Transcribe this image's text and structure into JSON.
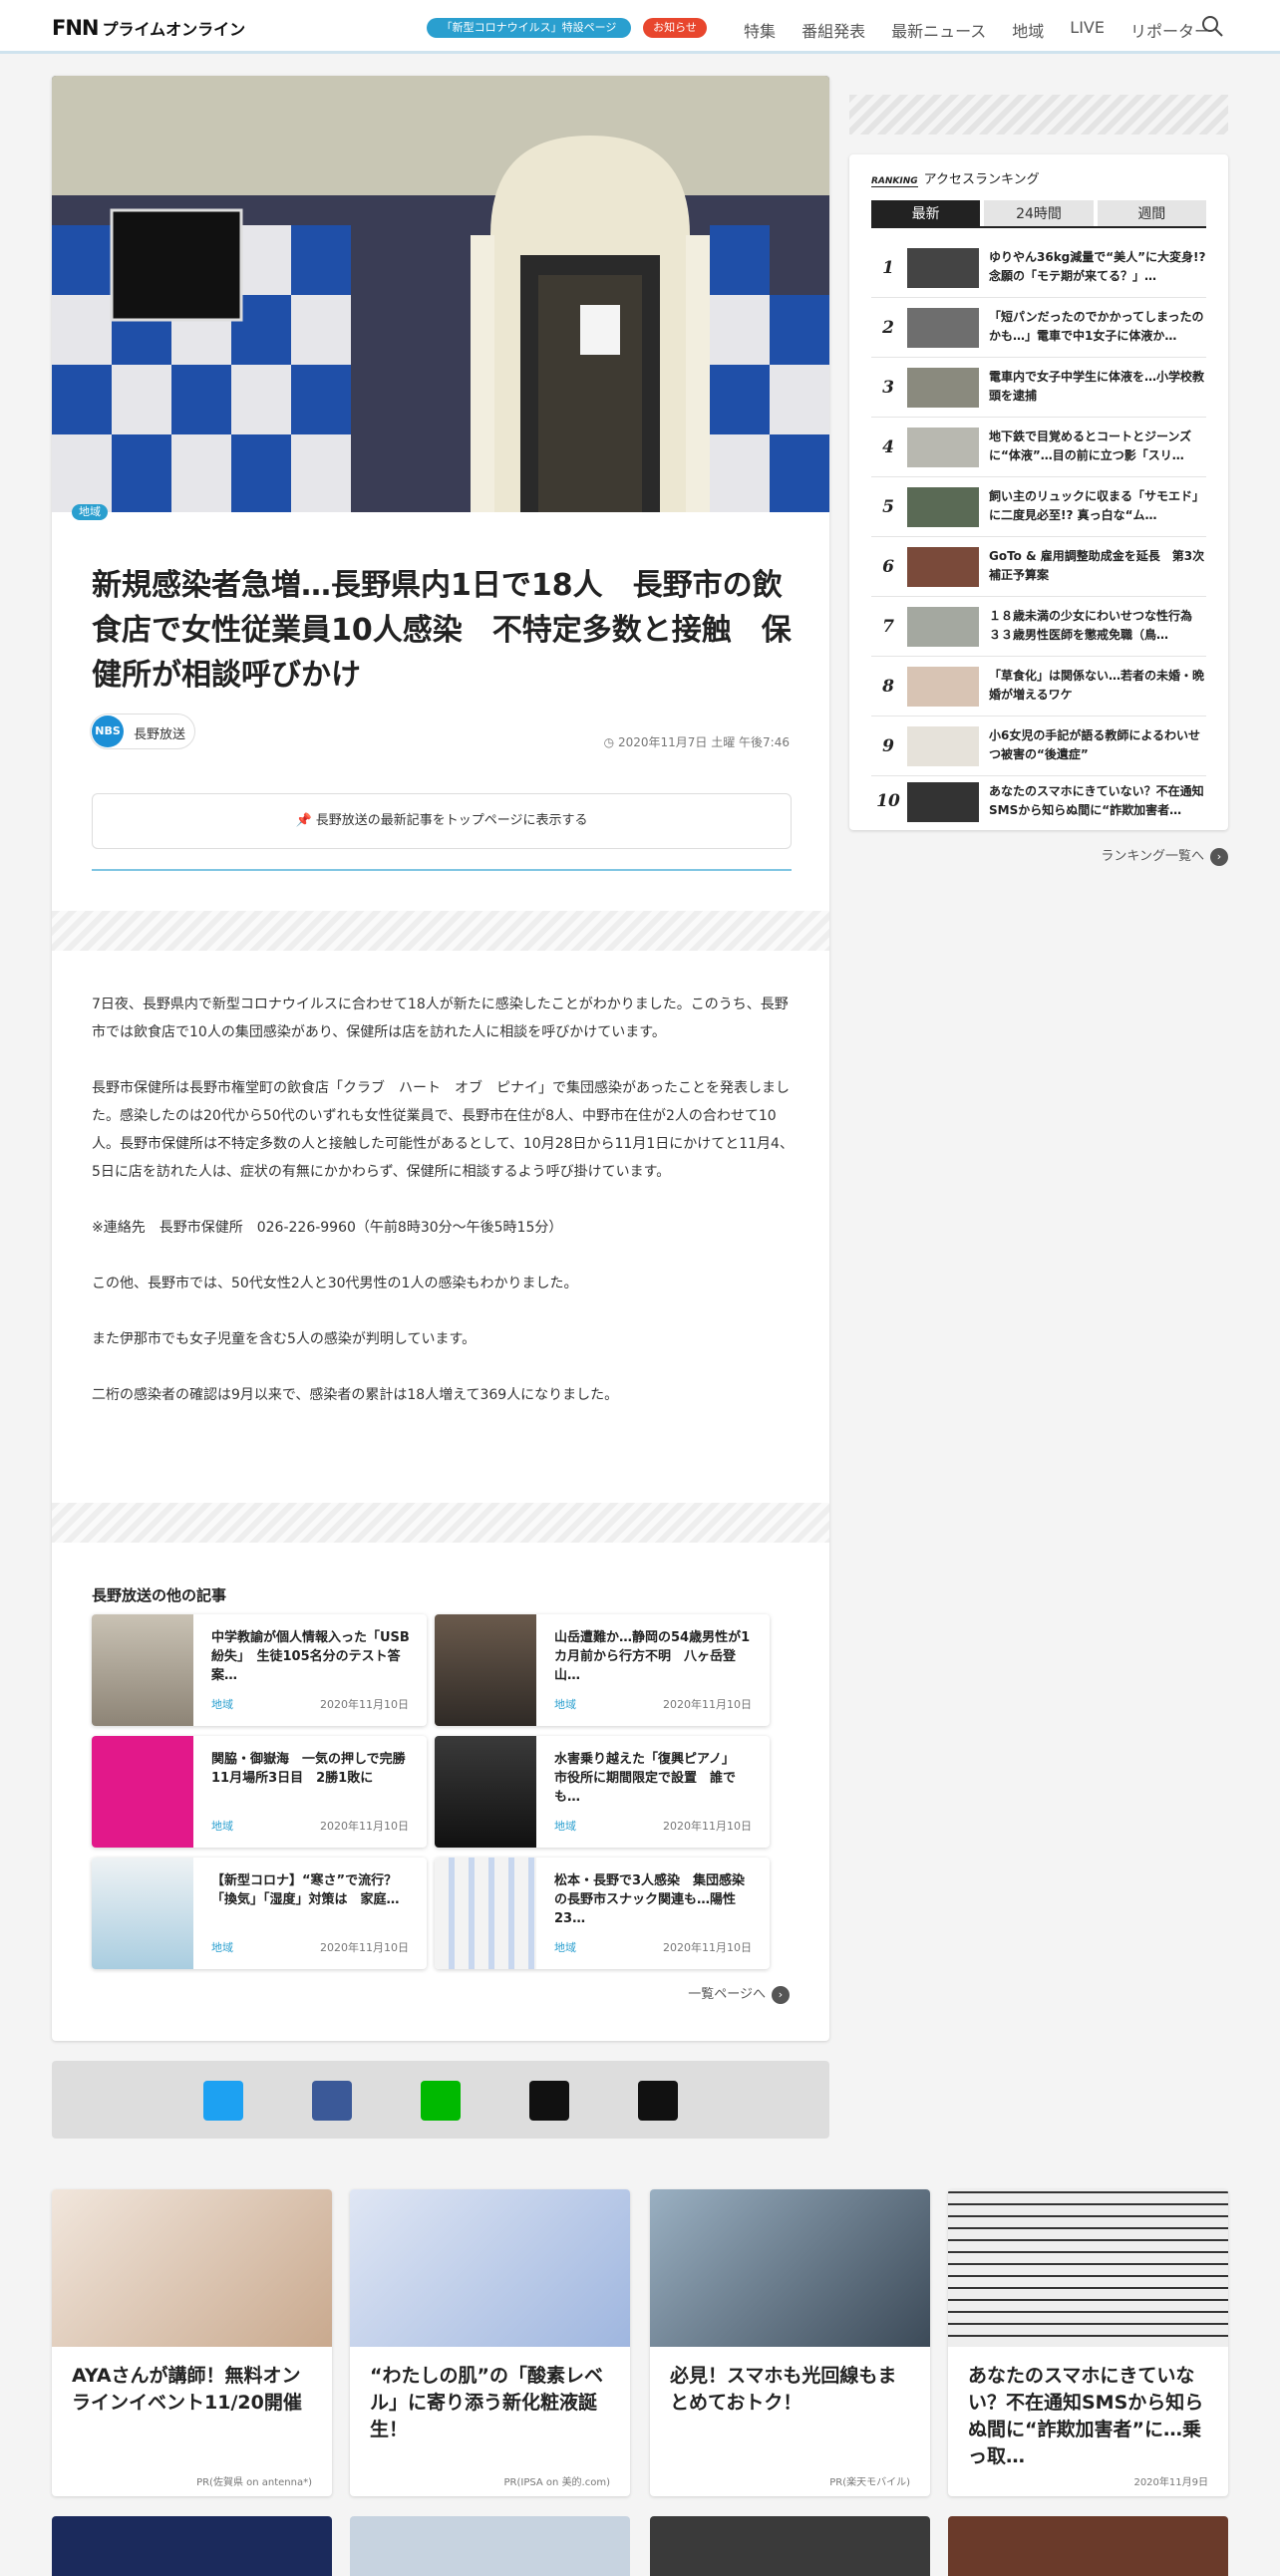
{
  "header": {
    "logo_mark": "FNN",
    "logo_text": "プライムオンライン",
    "covid_pill": "「新型コロナウイルス」特設ページ",
    "notice_pill": "お知らせ",
    "nav": [
      "特集",
      "番組発表",
      "最新ニュース",
      "地域",
      "LIVE",
      "リポーター"
    ]
  },
  "article": {
    "category": "地域",
    "title": "新規感染者急増…長野県内1日で18人　長野市の飲食店で女性従業員10人感染　不特定多数と接触　保健所が相談呼びかけ",
    "source_logo": "NBS",
    "source_name": "長野放送",
    "date": "2020年11月7日 土曜 午後7:46",
    "follow_label": "長野放送の最新記事をトップページに表示する",
    "paragraphs": [
      "7日夜、長野県内で新型コロナウイルスに合わせて18人が新たに感染したことがわかりました。このうち、長野市では飲食店で10人の集団感染があり、保健所は店を訪れた人に相談を呼びかけています。",
      "長野市保健所は長野市権堂町の飲食店「クラブ　ハート　オブ　ピナイ」で集団感染があったことを発表しました。感染したのは20代から50代のいずれも女性従業員で、長野市在住が8人、中野市在住が2人の合わせて10人。長野市保健所は不特定多数の人と接触した可能性があるとして、10月28日から11月1日にかけてと11月4、5日に店を訪れた人は、症状の有無にかかわらず、保健所に相談するよう呼び掛けています。",
      "※連絡先　長野市保健所　026-226-9960（午前8時30分～午後5時15分）",
      "この他、長野市では、50代女性2人と30代男性の1人の感染もわかりました。",
      "また伊那市でも女子児童を含む5人の感染が判明しています。",
      "二桁の感染者の確認は9月以来で、感染者の累計は18人増えて369人になりました。"
    ]
  },
  "related": {
    "heading": "長野放送の他の記事",
    "items": [
      {
        "title": "中学教諭が個人情報入った「USB紛失」　生徒105名分のテスト答案…",
        "category": "地域",
        "date": "2020年11月10日"
      },
      {
        "title": "山岳遭難か…静岡の54歳男性が1カ月前から行方不明　八ヶ岳登山…",
        "category": "地域",
        "date": "2020年11月10日"
      },
      {
        "title": "関脇・御嶽海　一気の押しで完勝　11月場所3日目　2勝1敗に",
        "category": "地域",
        "date": "2020年11月10日"
      },
      {
        "title": "水害乗り越えた「復興ピアノ」　市役所に期間限定で設置　誰でも…",
        "category": "地域",
        "date": "2020年11月10日"
      },
      {
        "title": "【新型コロナ】“寒さ”で流行？　「換気」「湿度」対策は　家庭…",
        "category": "地域",
        "date": "2020年11月10日"
      },
      {
        "title": "松本・長野で3人感染　集団感染の長野市スナック関連も…陽性23…",
        "category": "地域",
        "date": "2020年11月10日"
      }
    ],
    "more_label": "一覧ページへ"
  },
  "share": {
    "icons": [
      "twitter-icon",
      "facebook-icon",
      "line-icon",
      "link-icon",
      "comment-icon"
    ],
    "colors": [
      "#1da1f2",
      "#3b5998",
      "#00b900",
      "#111111",
      "#111111"
    ]
  },
  "ranking": {
    "badge": "RANKING",
    "title": "アクセスランキング",
    "tabs": [
      "最新",
      "24時間",
      "週間"
    ],
    "items": [
      {
        "rank": "1",
        "title": "ゆりやん36kg減量で“美人”に大変身!? 念願の「モテ期が来てる？」…"
      },
      {
        "rank": "2",
        "title": "「短パンだったのでかかってしまったのかも…」電車で中1女子に体液か…"
      },
      {
        "rank": "3",
        "title": "電車内で女子中学生に体液を…小学校教頭を逮捕"
      },
      {
        "rank": "4",
        "title": "地下鉄で目覚めるとコートとジーンズに“体液”…目の前に立つ影「スリ…"
      },
      {
        "rank": "5",
        "title": "飼い主のリュックに収まる「サモエド」に二度見必至!? 真っ白な“ム…"
      },
      {
        "rank": "6",
        "title": "GoTo & 雇用調整助成金を延長　第3次補正予算案"
      },
      {
        "rank": "7",
        "title": "１８歳未満の少女にわいせつな性行為　３３歳男性医師を懲戒免職（鳥…"
      },
      {
        "rank": "8",
        "title": "「草食化」は関係ない…若者の未婚・晩婚が増えるワケ"
      },
      {
        "rank": "9",
        "title": "小6女児の手記が語る教師によるわいせつ被害の“後遺症”"
      },
      {
        "rank": "10",
        "title": "あなたのスマホにきていない？不在通知SMSから知らぬ間に“詐欺加害者…"
      }
    ],
    "more_label": "ランキング一覧へ"
  },
  "promos": [
    {
      "title": "AYAさんが講師！無料オンラインイベント11/20開催",
      "sub": "PR(佐賀県 on antenna*)"
    },
    {
      "title": "“わたしの肌”の「酸素レベル」に寄り添う新化粧液誕生！",
      "sub": "PR(IPSA on 美的.com)"
    },
    {
      "title": "必見！スマホも光回線もまとめておトク！",
      "sub": "PR(楽天モバイル)"
    },
    {
      "title": "あなたのスマホにきていない？不在通知SMSから知らぬ間に“詐欺加害者”に…乗っ取…",
      "sub": "2020年11月9日"
    }
  ]
}
